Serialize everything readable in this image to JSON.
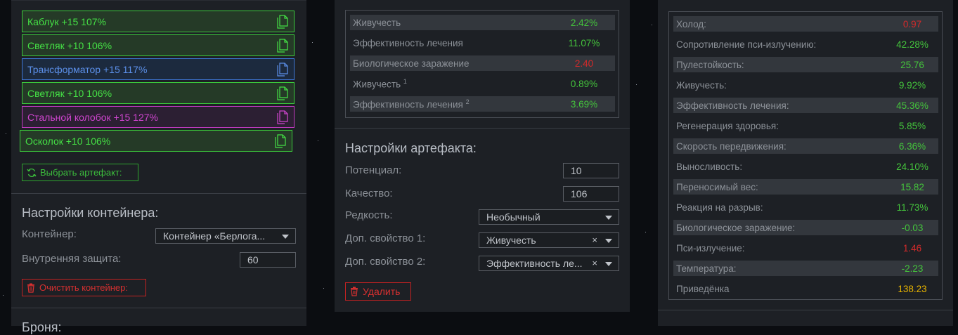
{
  "artifacts": [
    {
      "label": "Каблук +15 107%",
      "color": "green"
    },
    {
      "label": "Светляк +10 106%",
      "color": "green"
    },
    {
      "label": "Трансформатор +15 117%",
      "color": "blue"
    },
    {
      "label": "Светляк +10 106%",
      "color": "green"
    },
    {
      "label": "Стальной колобок +15 127%",
      "color": "purple"
    },
    {
      "label": "Осколок +10 106%",
      "color": "green"
    }
  ],
  "choose_artifact_label": "Выбрать артефакт:",
  "container_settings": {
    "title": "Настройки контейнера:",
    "container_label": "Контейнер:",
    "container_value": "Контейнер «Берлога...",
    "internal_protection_label": "Внутренняя защита:",
    "internal_protection_value": "60",
    "clear_label": "Очистить контейнер:",
    "next_title": "Броня:"
  },
  "artifact_stats": [
    {
      "name": "Живучесть",
      "sup": "",
      "value": "2.42%",
      "tone": "green"
    },
    {
      "name": "Эффективность лечения",
      "sup": "",
      "value": "11.07%",
      "tone": "green"
    },
    {
      "name": "Биологическое заражение",
      "sup": "",
      "value": "2.40",
      "tone": "red"
    },
    {
      "name": "Живучесть",
      "sup": "1",
      "value": "0.89%",
      "tone": "green"
    },
    {
      "name": "Эффективность лечения",
      "sup": "2",
      "value": "3.69%",
      "tone": "green"
    }
  ],
  "artifact_settings": {
    "title": "Настройки артефакта:",
    "potential_label": "Потенциал:",
    "potential_value": "10",
    "quality_label": "Качество:",
    "quality_value": "106",
    "rarity_label": "Редкость:",
    "rarity_value": "Необычный",
    "extra1_label": "Доп. свойство 1:",
    "extra1_value": "Живучесть",
    "extra2_label": "Доп. свойство 2:",
    "extra2_value": "Эффективность ле...",
    "delete_label": "Удалить"
  },
  "total_stats": [
    {
      "name": "Холод:",
      "value": "0.97",
      "tone": "red"
    },
    {
      "name": "Сопротивление пси-излучению:",
      "value": "42.28%",
      "tone": "green"
    },
    {
      "name": "Пулестойкость:",
      "value": "25.76",
      "tone": "green"
    },
    {
      "name": "Живучесть:",
      "value": "9.92%",
      "tone": "green"
    },
    {
      "name": "Эффективность лечения:",
      "value": "45.36%",
      "tone": "green"
    },
    {
      "name": "Регенерация здоровья:",
      "value": "5.85%",
      "tone": "green"
    },
    {
      "name": "Скорость передвижения:",
      "value": "6.36%",
      "tone": "green"
    },
    {
      "name": "Выносливость:",
      "value": "24.10%",
      "tone": "green"
    },
    {
      "name": "Переносимый вес:",
      "value": "15.82",
      "tone": "green"
    },
    {
      "name": "Реакция на разрыв:",
      "value": "11.73%",
      "tone": "green"
    },
    {
      "name": "Биологическое заражение:",
      "value": "-0.03",
      "tone": "green"
    },
    {
      "name": "Пси-излучение:",
      "value": "1.46",
      "tone": "red"
    },
    {
      "name": "Температура:",
      "value": "-2.23",
      "tone": "green"
    },
    {
      "name": "Приведёнка",
      "value": "138.23",
      "tone": "gold"
    }
  ],
  "colors": {
    "green": "#45e045",
    "blue": "#5b8fe8",
    "purple": "#cf45cf",
    "red": "#d42a2a",
    "gold": "#e8b400"
  },
  "icons": {
    "artifact_doc": "document-icon",
    "refresh": "refresh-icon",
    "trash": "trash-icon",
    "clear": "clear-x-icon",
    "dropdown": "chevron-down-icon"
  }
}
